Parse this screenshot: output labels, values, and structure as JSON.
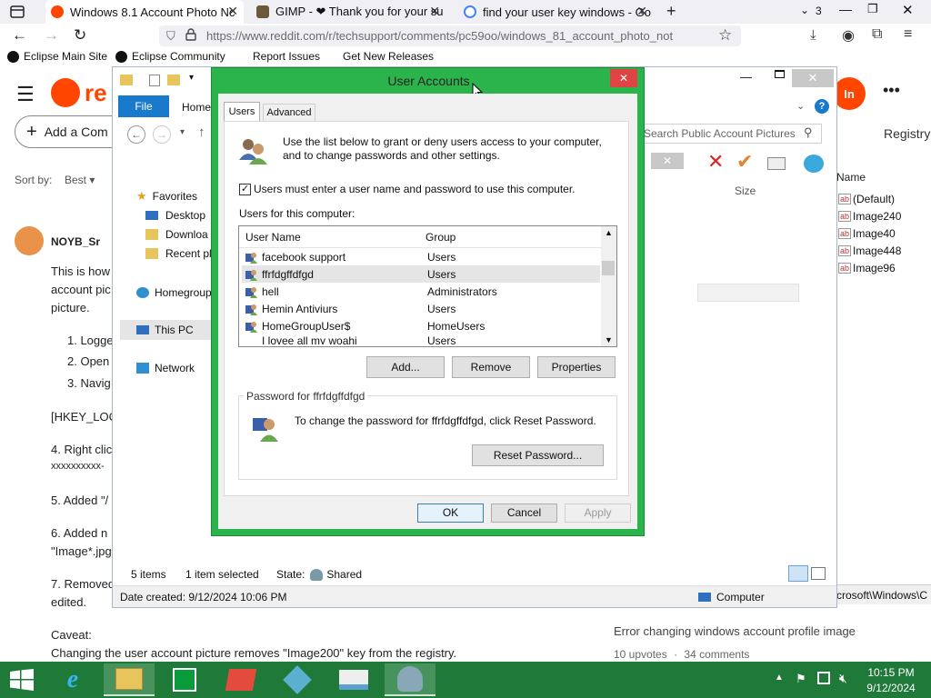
{
  "browser": {
    "tabs": [
      {
        "label": "Windows 8.1 Account Photo Nc",
        "active": true
      },
      {
        "label": "GIMP - ❤ Thank you for your su",
        "active": false
      },
      {
        "label": "find your user key windows - Go",
        "active": false
      }
    ],
    "tab_count": "3",
    "new_tab": "+",
    "url": "https://www.reddit.com/r/techsupport/comments/pc59oo/windows_81_account_photo_not",
    "bookmarks": [
      "Eclipse Main Site",
      "Eclipse Community",
      "Report Issues",
      "Get New Releases"
    ]
  },
  "reddit": {
    "logo_text": "re",
    "add_comment": "Add a Com",
    "sort_label": "Sort by:",
    "sort_value": "Best",
    "username": "NOYB_Sr",
    "profile_initials": "In",
    "body_lines": [
      "This is how",
      "account pic",
      "picture."
    ],
    "list_items": [
      "1. Logge",
      "2. Open",
      "3. Navig"
    ],
    "hkey": "[HKEY_LOC",
    "step4": "4. Right clic",
    "step4b": "xxxxxxxxxx-",
    "step5": "5. Added \"/",
    "step6": "6. Added n",
    "step6b": "\"Image*.jpg",
    "step7": "7. Removed",
    "step7b": "edited.",
    "caveat": "Caveat:",
    "caveat_text": "Changing the user account picture removes \"Image200\" key from the registry.",
    "related_title": "Error changing windows account profile image",
    "related_upvotes": "10 upvotes",
    "related_sep": "·",
    "related_comments": "34 comments"
  },
  "explorer": {
    "ribbon_file": "File",
    "ribbon_home": "Home",
    "search_placeholder": "Search Public Account Pictures",
    "column_size": "Size",
    "nav": {
      "favorites": "Favorites",
      "desktop": "Desktop",
      "downloads": "Downloa",
      "recent": "Recent pla",
      "homegroup": "Homegroup",
      "thispc": "This PC",
      "network": "Network"
    },
    "status_items": "5 items",
    "status_selected": "1 item selected",
    "status_state_label": "State:",
    "status_state_value": "Shared",
    "date_created": "Date created: 9/12/2024 10:06 PM",
    "computer_label": "Computer"
  },
  "regedit": {
    "title": "Registry",
    "col_name": "Name",
    "values": [
      "(Default)",
      "Image240",
      "Image40",
      "Image448",
      "Image96"
    ],
    "path": "crosoft\\Windows\\C"
  },
  "dialog": {
    "title": "User Accounts",
    "tabs": [
      "Users",
      "Advanced"
    ],
    "intro": "Use the list below to grant or deny users access to your computer, and to change passwords and other settings.",
    "intro_line1": "Use the list below to grant or deny users access to your computer,",
    "intro_line2": "and to change passwords and other settings.",
    "checkbox_label": "Users must enter a user name and password to use this computer.",
    "checkbox_checked": true,
    "users_label": "Users for this computer:",
    "columns": [
      "User Name",
      "Group"
    ],
    "users": [
      {
        "name": "facebook support",
        "group": "Users"
      },
      {
        "name": "ffrfdgffdfgd",
        "group": "Users"
      },
      {
        "name": "hell",
        "group": "Administrators"
      },
      {
        "name": "Hemin Antiviurs",
        "group": "Users"
      },
      {
        "name": "HomeGroupUser$",
        "group": "HomeUsers"
      },
      {
        "name": "I lovee all my woahi",
        "group": "Users"
      }
    ],
    "selected_user_index": 1,
    "btn_add": "Add...",
    "btn_remove": "Remove",
    "btn_properties": "Properties",
    "password_group": "Password for ffrfdgffdfgd",
    "password_text": "To change the password for ffrfdgffdfgd, click Reset Password.",
    "btn_reset": "Reset Password...",
    "btn_ok": "OK",
    "btn_cancel": "Cancel",
    "btn_apply": "Apply",
    "close_glyph": "✕"
  },
  "taskbar": {
    "time": "10:15 PM",
    "date": "9/12/2024"
  },
  "colors": {
    "dialog_frame": "#2bb44b",
    "taskbar": "#1f7a3a",
    "reddit_orange": "#ff4500",
    "close_red": "#e04343"
  }
}
